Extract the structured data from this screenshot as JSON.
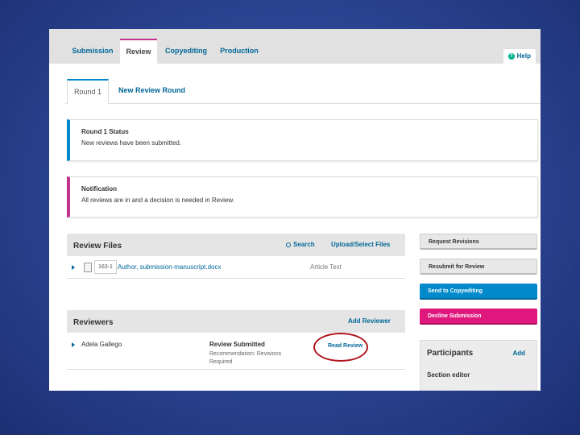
{
  "top_tabs": [
    "Submission",
    "Review",
    "Copyediting",
    "Production"
  ],
  "help_label": "Help",
  "round_tabs": [
    "Round 1",
    "New Review Round"
  ],
  "status_box": {
    "title": "Round 1 Status",
    "text": "New reviews have been submitted."
  },
  "notification_box": {
    "title": "Notification",
    "text": "All reviews are in and a decision is needed in Review."
  },
  "review_files": {
    "title": "Review Files",
    "search_label": "Search",
    "upload_label": "Upload/Select Files",
    "rows": [
      {
        "id": "163-1",
        "name": "Author, submission-manuscript.docx",
        "type": "Article Text"
      }
    ]
  },
  "reviewers": {
    "title": "Reviewers",
    "add_label": "Add Reviewer",
    "rows": [
      {
        "name": "Adela Gallego",
        "status": "Review Submitted",
        "recommendation": "Recommendation: Revisions Required",
        "action": "Read Review"
      }
    ]
  },
  "sidebar": {
    "request_revisions": "Request Revisions",
    "resubmit": "Resubmit for Review",
    "send_copyediting": "Send to Copyediting",
    "decline": "Decline Submission"
  },
  "participants": {
    "title": "Participants",
    "add_label": "Add",
    "section": "Section editor"
  },
  "colors": {
    "accent_blue": "#008acb",
    "accent_pink": "#c2338d",
    "link": "#006798",
    "highlight": "#b0151c"
  }
}
